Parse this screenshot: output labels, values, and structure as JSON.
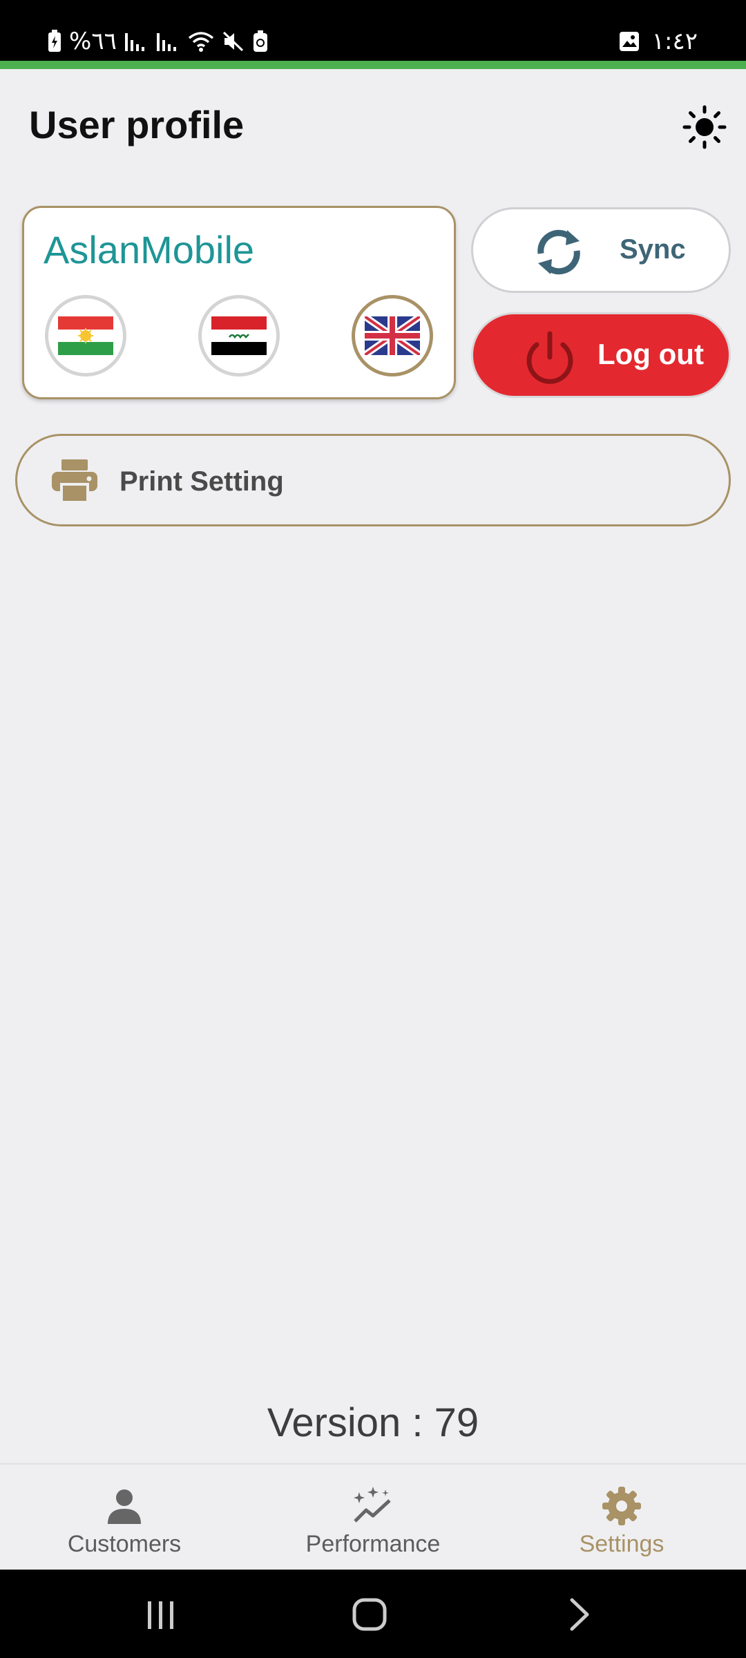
{
  "status_bar": {
    "battery_text": "%٦٦",
    "time": "١:٤٢"
  },
  "header": {
    "title": "User profile",
    "theme_icon": "sun-icon"
  },
  "profile": {
    "name": "AslanMobile",
    "languages": [
      {
        "flag": "kurdistan-flag-icon",
        "selected": false
      },
      {
        "flag": "iraq-flag-icon",
        "selected": false
      },
      {
        "flag": "uk-flag-icon",
        "selected": true
      }
    ]
  },
  "actions": {
    "sync_label": "Sync",
    "logout_label": "Log out"
  },
  "print_setting": {
    "label": "Print Setting"
  },
  "version": "Version : 79",
  "bottom_nav": [
    {
      "label": "Customers",
      "icon": "person-icon",
      "active": false
    },
    {
      "label": "Performance",
      "icon": "sparkle-chart-icon",
      "active": false
    },
    {
      "label": "Settings",
      "icon": "gear-icon",
      "active": true
    }
  ],
  "colors": {
    "accent": "#a89266",
    "brand_teal": "#1e9596",
    "logout_red": "#e3292f",
    "progress_green": "#4caf50"
  }
}
